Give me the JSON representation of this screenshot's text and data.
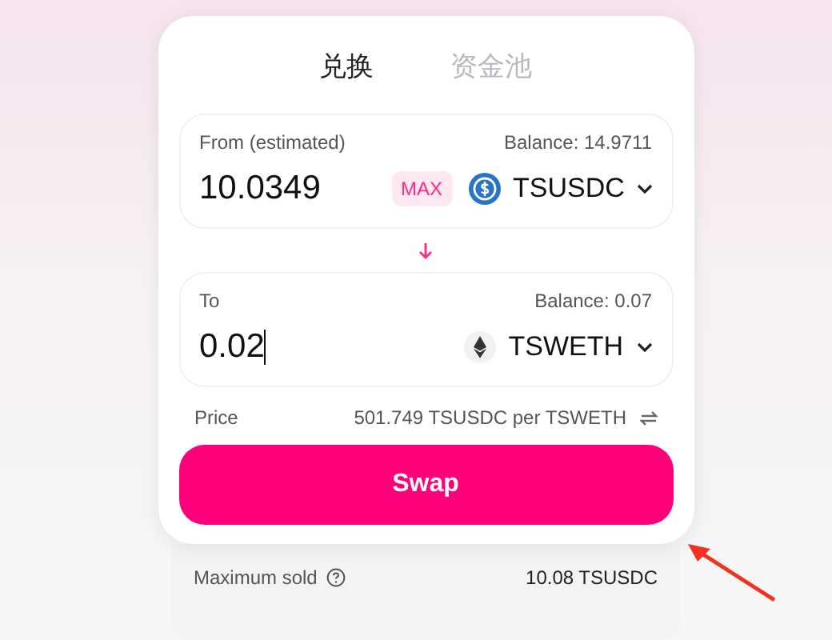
{
  "tabs": [
    {
      "label": "兑换",
      "selected": true
    },
    {
      "label": "资金池",
      "selected": false
    }
  ],
  "from": {
    "label": "From (estimated)",
    "balance": "Balance: 14.9711",
    "amount": "10.0349",
    "max": "MAX",
    "token": "TSUSDC",
    "kind": "usdc"
  },
  "to": {
    "label": "To",
    "balance": "Balance: 0.07",
    "amount": "0.02",
    "token": "TSWETH",
    "kind": "eth"
  },
  "price": {
    "label": "Price",
    "value": "501.749 TSUSDC per TSWETH"
  },
  "swap_button": "Swap",
  "details": [
    {
      "label": "Maximum sold",
      "value": "10.08 TSUSDC"
    }
  ]
}
